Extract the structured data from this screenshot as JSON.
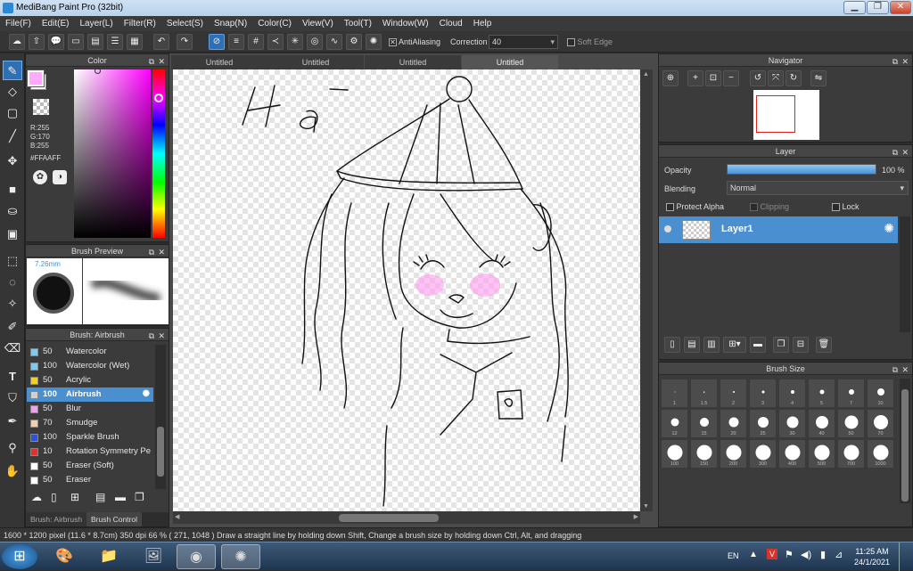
{
  "window": {
    "title": "MediBang Paint Pro (32bit)"
  },
  "menu": [
    "File(F)",
    "Edit(E)",
    "Layer(L)",
    "Filter(R)",
    "Select(S)",
    "Snap(N)",
    "Color(C)",
    "View(V)",
    "Tool(T)",
    "Window(W)",
    "Cloud",
    "Help"
  ],
  "toolbar": {
    "antialias_label": "AntiAliasing",
    "correction_label": "Correction",
    "correction_value": "40",
    "soft_edge_label": "Soft Edge"
  },
  "tabs": [
    "Untitled",
    "Untitled",
    "Untitled",
    "Untitled"
  ],
  "color_panel": {
    "title": "Color",
    "r": "R:255",
    "g": "G:170",
    "b": "B:255",
    "hex": "#FFAAFF",
    "foreground": "#ffaaff",
    "background": "#ffffff"
  },
  "brush_preview": {
    "title": "Brush Preview",
    "size": "7.26mm"
  },
  "brush_list": {
    "title": "Brush: Airbrush",
    "items": [
      {
        "size": "50",
        "name": "Watercolor",
        "color": "#7ecbf0"
      },
      {
        "size": "100",
        "name": "Watercolor (Wet)",
        "color": "#7ecbf0"
      },
      {
        "size": "50",
        "name": "Acrylic",
        "color": "#f0d020"
      },
      {
        "size": "100",
        "name": "Airbrush",
        "color": "#d0d0d0"
      },
      {
        "size": "50",
        "name": "Blur",
        "color": "#f0a0f0"
      },
      {
        "size": "70",
        "name": "Smudge",
        "color": "#f0d0b0"
      },
      {
        "size": "100",
        "name": "Sparkle Brush",
        "color": "#3050e0"
      },
      {
        "size": "10",
        "name": "Rotation Symmetry Pe",
        "color": "#e03030"
      },
      {
        "size": "50",
        "name": "Eraser (Soft)",
        "color": "#ffffff"
      },
      {
        "size": "50",
        "name": "Eraser",
        "color": "#ffffff"
      }
    ]
  },
  "bottom_tabs": {
    "brush": "Brush: Airbrush",
    "control": "Brush Control"
  },
  "navigator": {
    "title": "Navigator"
  },
  "layer_panel": {
    "title": "Layer",
    "opacity_label": "Opacity",
    "opacity_value": "100 %",
    "opacity_fraction": 1.0,
    "blending_label": "Blending",
    "blending_value": "Normal",
    "protect_alpha": "Protect Alpha",
    "clipping": "Clipping",
    "lock": "Lock",
    "layer_name": "Layer1"
  },
  "brush_size": {
    "title": "Brush Size",
    "sizes": [
      "1",
      "1.5",
      "2",
      "3",
      "4",
      "5",
      "7",
      "10",
      "12",
      "15",
      "20",
      "25",
      "30",
      "40",
      "50",
      "70",
      "100",
      "150",
      "200",
      "300",
      "400",
      "500",
      "700",
      "1000"
    ]
  },
  "canvas_text": "Hà",
  "status": "1600 * 1200 pixel   (11.6 * 8.7cm)   350 dpi   66 %   ( 271, 1048 )   Draw a straight line by holding down Shift, Change a brush size by holding down Ctrl, Alt, and dragging",
  "taskbar": {
    "lang": "EN",
    "time": "11:25 AM",
    "date": "24/1/2021"
  }
}
